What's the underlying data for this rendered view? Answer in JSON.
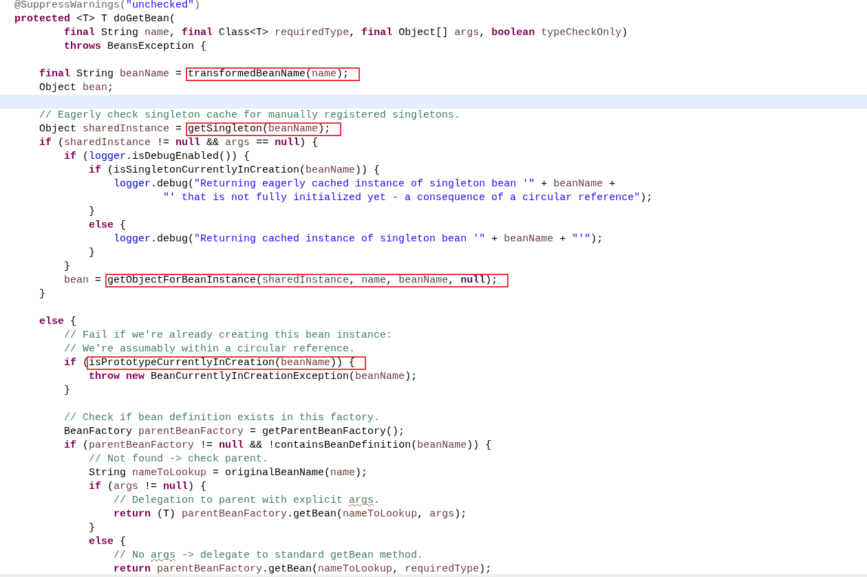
{
  "lines": [
    {
      "current": false,
      "tokens": [
        {
          "kind": "annotation",
          "text": "@SuppressWarnings("
        },
        {
          "kind": "string",
          "text": "\"unchecked\""
        },
        {
          "kind": "annotation",
          "text": ")"
        }
      ]
    },
    {
      "current": false,
      "tokens": [
        {
          "kind": "keyword",
          "text": "protected"
        },
        {
          "kind": "plain",
          "text": " <T> T doGetBean("
        }
      ]
    },
    {
      "current": false,
      "tokens": [
        {
          "kind": "keyword",
          "text": "        final"
        },
        {
          "kind": "plain",
          "text": " String "
        },
        {
          "kind": "variable",
          "text": "name"
        },
        {
          "kind": "plain",
          "text": ", "
        },
        {
          "kind": "keyword",
          "text": "final"
        },
        {
          "kind": "plain",
          "text": " Class<T> "
        },
        {
          "kind": "variable",
          "text": "requiredType"
        },
        {
          "kind": "plain",
          "text": ", "
        },
        {
          "kind": "keyword",
          "text": "final"
        },
        {
          "kind": "plain",
          "text": " Object[] "
        },
        {
          "kind": "variable",
          "text": "args"
        },
        {
          "kind": "plain",
          "text": ", "
        },
        {
          "kind": "keyword",
          "text": "boolean"
        },
        {
          "kind": "variable",
          "text": " typeCheckOnly"
        },
        {
          "kind": "plain",
          "text": ")"
        }
      ]
    },
    {
      "current": false,
      "tokens": [
        {
          "kind": "keyword",
          "text": "        throws"
        },
        {
          "kind": "plain",
          "text": " BeansException {"
        }
      ]
    },
    {
      "current": false
    },
    {
      "current": false,
      "tokens": [
        {
          "kind": "keyword",
          "text": "    final"
        },
        {
          "kind": "plain",
          "text": " String "
        },
        {
          "kind": "variable",
          "text": "beanName"
        },
        {
          "kind": "plain",
          "text": " = "
        },
        {
          "kind": "box",
          "tokens": [
            {
              "kind": "plain",
              "text": "transformedBeanName("
            },
            {
              "kind": "variable",
              "text": "name"
            },
            {
              "kind": "plain",
              "text": ");"
            }
          ]
        }
      ]
    },
    {
      "current": false,
      "tokens": [
        {
          "kind": "plain",
          "text": "    Object "
        },
        {
          "kind": "variable",
          "text": "bean"
        },
        {
          "kind": "plain",
          "text": ";"
        }
      ]
    },
    {
      "current": true
    },
    {
      "current": false,
      "tokens": [
        {
          "kind": "comment",
          "text": "    // Eagerly check singleton cache for manually registered singletons."
        }
      ]
    },
    {
      "current": false,
      "tokens": [
        {
          "kind": "plain",
          "text": "    Object "
        },
        {
          "kind": "variable",
          "text": "sharedInstance"
        },
        {
          "kind": "plain",
          "text": " = "
        },
        {
          "kind": "box",
          "tokens": [
            {
              "kind": "plain",
              "text": "getSingleton("
            },
            {
              "kind": "variable",
              "text": "beanName"
            },
            {
              "kind": "plain",
              "text": ");"
            }
          ]
        }
      ]
    },
    {
      "current": false,
      "tokens": [
        {
          "kind": "keyword",
          "text": "    if"
        },
        {
          "kind": "plain",
          "text": " ("
        },
        {
          "kind": "variable",
          "text": "sharedInstance"
        },
        {
          "kind": "plain",
          "text": " != "
        },
        {
          "kind": "keyword",
          "text": "null"
        },
        {
          "kind": "plain",
          "text": " && "
        },
        {
          "kind": "variable",
          "text": "args"
        },
        {
          "kind": "plain",
          "text": " == "
        },
        {
          "kind": "keyword",
          "text": "null"
        },
        {
          "kind": "plain",
          "text": ") {"
        }
      ]
    },
    {
      "current": false,
      "tokens": [
        {
          "kind": "keyword",
          "text": "        if"
        },
        {
          "kind": "plain",
          "text": " ("
        },
        {
          "kind": "field",
          "text": "logger"
        },
        {
          "kind": "plain",
          "text": ".isDebugEnabled()) {"
        }
      ]
    },
    {
      "current": false,
      "tokens": [
        {
          "kind": "keyword",
          "text": "            if"
        },
        {
          "kind": "plain",
          "text": " (isSingletonCurrentlyInCreation("
        },
        {
          "kind": "variable",
          "text": "beanName"
        },
        {
          "kind": "plain",
          "text": ")) {"
        }
      ]
    },
    {
      "current": false,
      "tokens": [
        {
          "kind": "field",
          "text": "                logger"
        },
        {
          "kind": "plain",
          "text": ".debug("
        },
        {
          "kind": "string",
          "text": "\"Returning eagerly cached instance of singleton bean '\""
        },
        {
          "kind": "plain",
          "text": " + "
        },
        {
          "kind": "variable",
          "text": "beanName"
        },
        {
          "kind": "plain",
          "text": " +"
        }
      ]
    },
    {
      "current": false,
      "tokens": [
        {
          "kind": "string",
          "text": "                        \"' that is not fully initialized yet - a consequence of a circular reference\""
        },
        {
          "kind": "plain",
          "text": ");"
        }
      ]
    },
    {
      "current": false,
      "tokens": [
        {
          "kind": "plain",
          "text": "            }"
        }
      ]
    },
    {
      "current": false,
      "tokens": [
        {
          "kind": "keyword",
          "text": "            else"
        },
        {
          "kind": "plain",
          "text": " {"
        }
      ]
    },
    {
      "current": false,
      "tokens": [
        {
          "kind": "field",
          "text": "                logger"
        },
        {
          "kind": "plain",
          "text": ".debug("
        },
        {
          "kind": "string",
          "text": "\"Returning cached instance of singleton bean '\""
        },
        {
          "kind": "plain",
          "text": " + "
        },
        {
          "kind": "variable",
          "text": "beanName"
        },
        {
          "kind": "plain",
          "text": " + "
        },
        {
          "kind": "string",
          "text": "\"'\""
        },
        {
          "kind": "plain",
          "text": ");"
        }
      ]
    },
    {
      "current": false,
      "tokens": [
        {
          "kind": "plain",
          "text": "            }"
        }
      ]
    },
    {
      "current": false,
      "tokens": [
        {
          "kind": "plain",
          "text": "        }"
        }
      ]
    },
    {
      "current": false,
      "tokens": [
        {
          "kind": "variable",
          "text": "        bean"
        },
        {
          "kind": "plain",
          "text": " = "
        },
        {
          "kind": "box",
          "tokens": [
            {
              "kind": "plain",
              "text": "getObjectForBeanInstance("
            },
            {
              "kind": "variable",
              "text": "sharedInstance"
            },
            {
              "kind": "plain",
              "text": ", "
            },
            {
              "kind": "variable",
              "text": "name"
            },
            {
              "kind": "plain",
              "text": ", "
            },
            {
              "kind": "variable",
              "text": "beanName"
            },
            {
              "kind": "plain",
              "text": ", "
            },
            {
              "kind": "keyword",
              "text": "null"
            },
            {
              "kind": "plain",
              "text": ");"
            }
          ]
        }
      ]
    },
    {
      "current": false,
      "tokens": [
        {
          "kind": "plain",
          "text": "    }"
        }
      ]
    },
    {
      "current": false
    },
    {
      "current": false,
      "tokens": [
        {
          "kind": "keyword",
          "text": "    else"
        },
        {
          "kind": "plain",
          "text": " {"
        }
      ]
    },
    {
      "current": false,
      "tokens": [
        {
          "kind": "comment",
          "text": "        // Fail if we're already creating this bean instance:"
        }
      ]
    },
    {
      "current": false,
      "tokens": [
        {
          "kind": "comment",
          "text": "        // We're assumably within a circular reference."
        }
      ]
    },
    {
      "current": false,
      "tokens": [
        {
          "kind": "keyword",
          "text": "        if"
        },
        {
          "kind": "plain",
          "text": " ("
        },
        {
          "kind": "box",
          "tokens": [
            {
              "kind": "plain",
              "text": "isPrototypeCurrentlyInCreation("
            },
            {
              "kind": "variable",
              "text": "beanName"
            },
            {
              "kind": "plain",
              "text": ")) {"
            }
          ]
        }
      ]
    },
    {
      "current": false,
      "tokens": [
        {
          "kind": "keyword",
          "text": "            throw"
        },
        {
          "kind": "keyword",
          "text": " new"
        },
        {
          "kind": "plain",
          "text": " BeanCurrentlyInCreationException("
        },
        {
          "kind": "variable",
          "text": "beanName"
        },
        {
          "kind": "plain",
          "text": ");"
        }
      ]
    },
    {
      "current": false,
      "tokens": [
        {
          "kind": "plain",
          "text": "        }"
        }
      ]
    },
    {
      "current": false
    },
    {
      "current": false,
      "tokens": [
        {
          "kind": "comment",
          "text": "        // Check if bean definition exists in this factory."
        }
      ]
    },
    {
      "current": false,
      "tokens": [
        {
          "kind": "plain",
          "text": "        BeanFactory "
        },
        {
          "kind": "variable",
          "text": "parentBeanFactory"
        },
        {
          "kind": "plain",
          "text": " = getParentBeanFactory();"
        }
      ]
    },
    {
      "current": false,
      "tokens": [
        {
          "kind": "keyword",
          "text": "        if"
        },
        {
          "kind": "plain",
          "text": " ("
        },
        {
          "kind": "variable",
          "text": "parentBeanFactory"
        },
        {
          "kind": "plain",
          "text": " != "
        },
        {
          "kind": "keyword",
          "text": "null"
        },
        {
          "kind": "plain",
          "text": " && !containsBeanDefinition("
        },
        {
          "kind": "variable",
          "text": "beanName"
        },
        {
          "kind": "plain",
          "text": ")) {"
        }
      ]
    },
    {
      "current": false,
      "tokens": [
        {
          "kind": "comment",
          "text": "            // Not found -> check parent."
        }
      ]
    },
    {
      "current": false,
      "tokens": [
        {
          "kind": "plain",
          "text": "            String "
        },
        {
          "kind": "variable",
          "text": "nameToLookup"
        },
        {
          "kind": "plain",
          "text": " = originalBeanName("
        },
        {
          "kind": "variable",
          "text": "name"
        },
        {
          "kind": "plain",
          "text": ");"
        }
      ]
    },
    {
      "current": false,
      "tokens": [
        {
          "kind": "keyword",
          "text": "            if"
        },
        {
          "kind": "plain",
          "text": " ("
        },
        {
          "kind": "variable",
          "text": "args"
        },
        {
          "kind": "plain",
          "text": " != "
        },
        {
          "kind": "keyword",
          "text": "null"
        },
        {
          "kind": "plain",
          "text": ") {"
        }
      ]
    },
    {
      "current": false,
      "tokens": [
        {
          "kind": "comment",
          "text": "                // Delegation to parent with explicit "
        },
        {
          "kind": "misspelled",
          "text": "args"
        },
        {
          "kind": "comment",
          "text": "."
        }
      ]
    },
    {
      "current": false,
      "tokens": [
        {
          "kind": "keyword",
          "text": "                return"
        },
        {
          "kind": "plain",
          "text": " (T) "
        },
        {
          "kind": "variable",
          "text": "parentBeanFactory"
        },
        {
          "kind": "plain",
          "text": ".getBean("
        },
        {
          "kind": "variable",
          "text": "nameToLookup"
        },
        {
          "kind": "plain",
          "text": ", "
        },
        {
          "kind": "variable",
          "text": "args"
        },
        {
          "kind": "plain",
          "text": ");"
        }
      ]
    },
    {
      "current": false,
      "tokens": [
        {
          "kind": "plain",
          "text": "            }"
        }
      ]
    },
    {
      "current": false,
      "tokens": [
        {
          "kind": "keyword",
          "text": "            else"
        },
        {
          "kind": "plain",
          "text": " {"
        }
      ]
    },
    {
      "current": false,
      "tokens": [
        {
          "kind": "comment",
          "text": "                // No "
        },
        {
          "kind": "misspelled",
          "text": "args"
        },
        {
          "kind": "comment",
          "text": " -> delegate to standard getBean method."
        }
      ]
    },
    {
      "current": false,
      "tokens": [
        {
          "kind": "keyword",
          "text": "                return"
        },
        {
          "kind": "variable",
          "text": " parentBeanFactory"
        },
        {
          "kind": "plain",
          "text": ".getBean("
        },
        {
          "kind": "variable",
          "text": "nameToLookup"
        },
        {
          "kind": "plain",
          "text": ", "
        },
        {
          "kind": "variable",
          "text": "requiredType"
        },
        {
          "kind": "plain",
          "text": ");"
        }
      ]
    }
  ]
}
